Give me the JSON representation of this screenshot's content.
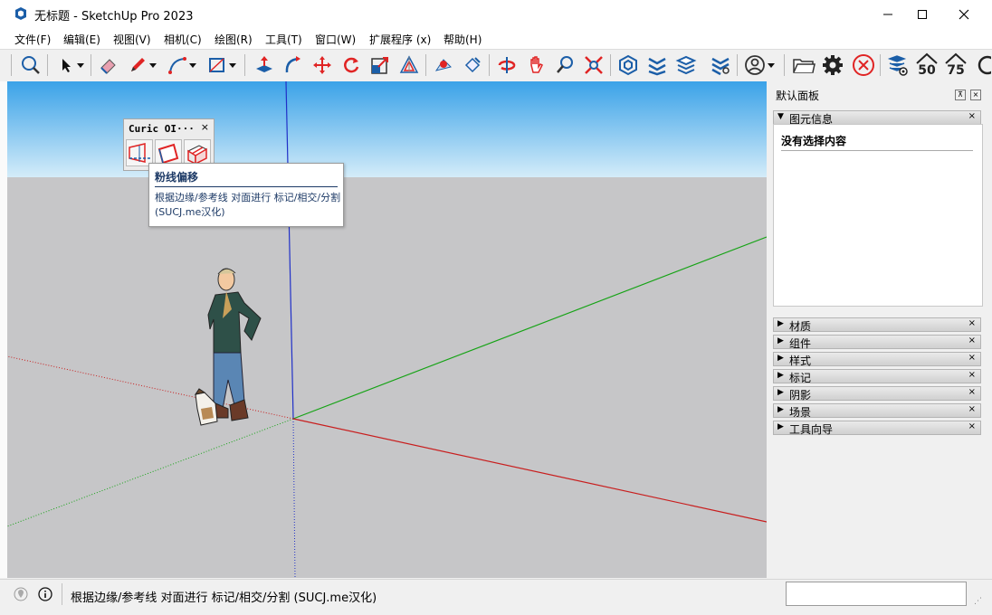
{
  "window": {
    "title": "无标题 - SketchUp Pro 2023"
  },
  "menu": [
    "文件(F)",
    "编辑(E)",
    "视图(V)",
    "相机(C)",
    "绘图(R)",
    "工具(T)",
    "窗口(W)",
    "扩展程序 (x)",
    "帮助(H)"
  ],
  "toolbar": {
    "icons": [
      "zoom-extents-icon",
      "select-icon",
      "eraser-icon",
      "pencil-icon",
      "arc-icon",
      "rectangle-icon",
      "push-pull-icon",
      "follow-me-icon",
      "move-icon",
      "rotate-icon",
      "scale-icon",
      "offset-icon",
      "orbit-icon",
      "pan-icon",
      "flip-icon",
      "hand-icon",
      "zoom-icon",
      "zoom-window-icon",
      "solid-tools-icon",
      "sandbox-icon",
      "layers-icon",
      "stack-icon",
      "account-icon",
      "folder-icon",
      "settings-icon",
      "close-circle-icon",
      "visibility-icon",
      "fifty-icon",
      "seventy-five-icon"
    ],
    "badge_50": "50",
    "badge_75": "75",
    "accent_red": "#e02424",
    "accent_blue": "#1b5ea8"
  },
  "curic_panel": {
    "title": "Curic OI···",
    "close": "×"
  },
  "tooltip": {
    "title": "粉线偏移",
    "body": "根据边缘/参考线 对面进行 标记/相交/分割 (SUCJ.me汉化)"
  },
  "default_panel": {
    "title": "默认面板",
    "pin": "⊼",
    "close": "×",
    "entity_info": {
      "label": "图元信息",
      "content": "没有选择内容"
    },
    "sections": [
      "材质",
      "组件",
      "样式",
      "标记",
      "阴影",
      "场景",
      "工具向导"
    ]
  },
  "status": {
    "text": "根据边缘/参考线 对面进行 标记/相交/分割 (SUCJ.me汉化)",
    "measurement_value": ""
  },
  "scene": {
    "sky_color": "#3aa2e8",
    "ground_color": "#c6c6c8",
    "axis_red": "#c81e1e",
    "axis_green": "#16a316",
    "axis_blue": "#2030c8"
  }
}
